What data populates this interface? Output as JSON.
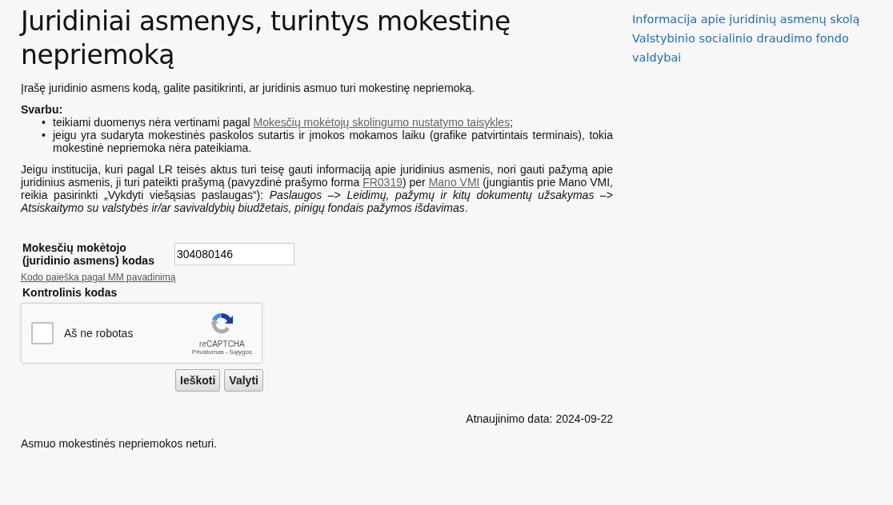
{
  "title": "Juridiniai asmenys, turintys mokestinę nepriemoką",
  "intro": "Įrašę juridinio asmens kodą, galite pasitikrinti, ar juridinis asmuo turi mokestinę nepriemoką.",
  "important": {
    "heading": "Svarbu:",
    "items": [
      {
        "marker": "•",
        "segments": [
          {
            "kind": "text",
            "text": "teikiami duomenys nėra vertinami pagal "
          },
          {
            "kind": "link",
            "text": "Mokesčių mokėtojų skolingumo nustatymo taisykles"
          },
          {
            "kind": "text",
            "text": ";"
          }
        ]
      },
      {
        "marker": "•",
        "segments": [
          {
            "kind": "text",
            "text": "jeigu yra sudaryta mokestinės paskolos sutartis ir įmokos mokamos laiku (grafike patvirtintais terminais), tokia mokestinė nepriemoka nėra pateikiama."
          }
        ]
      }
    ]
  },
  "paragraph": [
    {
      "kind": "text",
      "text": "Jeigu institucija, kuri pagal LR teisės aktus turi teisę gauti informaciją apie juridinius asmenis, nori gauti pažymą apie juridinius asmenis, ji turi pateikti prašymą (pavyzdinė prašymo forma "
    },
    {
      "kind": "link",
      "text": "FR0319"
    },
    {
      "kind": "text",
      "text": ") per "
    },
    {
      "kind": "link",
      "text": "Mano VMI"
    },
    {
      "kind": "text",
      "text": " (jungiantis prie Mano VMI, reikia pasirinkti „Vykdyti viešąsias paslaugas“): *Paslaugos –> Leidimų, pažymų ir kitų dokumentų užsakymas –> Atsiskaitymo su valstybės ir/ar savivaldybių biudžetais, pinigų fondais pažymos išdavimas*."
    }
  ],
  "form": {
    "code_label": "Mokesčių mokėtojo (juridinio asmens) kodas",
    "code_value": "304080146",
    "search_link": "Kodo paieška pagal MM pavadinimą",
    "control_label": "Kontrolinis kodas",
    "captcha": {
      "label": "Aš ne robotas",
      "checked": false,
      "brand": "reCAPTCHA",
      "privacy": "Privatumas",
      "separator": "-",
      "terms": "Sąlygos"
    },
    "buttons": [
      "Ieškoti",
      "Valyti"
    ]
  },
  "updated": "Atnaujinimo data: 2024-09-22",
  "result": "Asmuo mokestinės nepriemokos neturi.",
  "sidebar": {
    "links": [
      "Informacija apie juridinių asmenų skolą Valstybinio socialinio draudimo fondo valdybai"
    ]
  }
}
